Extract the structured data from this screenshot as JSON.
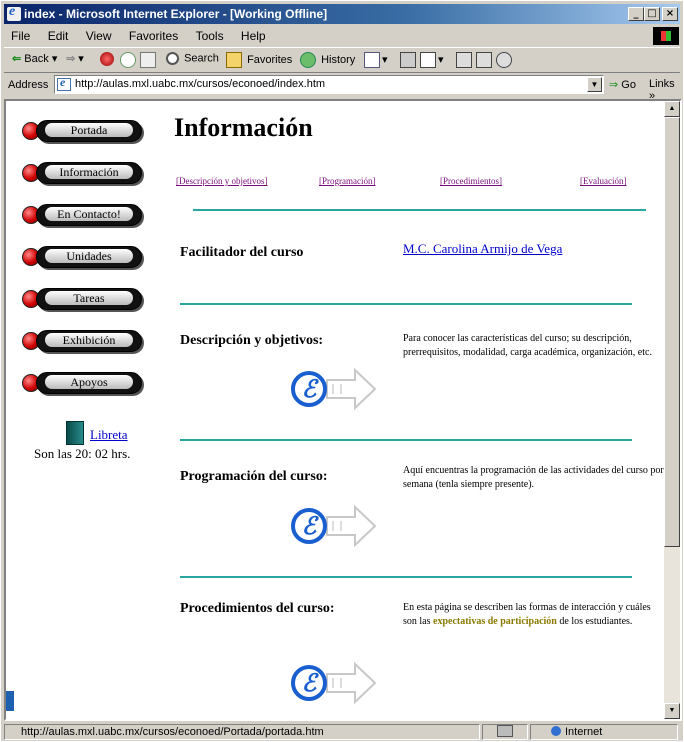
{
  "window": {
    "title": "index - Microsoft Internet Explorer - [Working Offline]",
    "min": "_",
    "max": "□",
    "close": "×"
  },
  "menu": [
    "File",
    "Edit",
    "View",
    "Favorites",
    "Tools",
    "Help"
  ],
  "toolbar": {
    "back": "Back",
    "search": "Search",
    "favorites": "Favorites",
    "history": "History"
  },
  "address": {
    "label": "Address",
    "url": "http://aulas.mxl.uabc.mx/cursos/econoed/index.htm",
    "go": "Go",
    "links": "Links »"
  },
  "nav": [
    "Portada",
    "Información",
    "En Contacto!",
    "Unidades",
    "Tareas",
    "Exhibición",
    "Apoyos"
  ],
  "sidebar": {
    "libreta": "Libreta",
    "clock": "Son las 20: 02 hrs."
  },
  "page": {
    "title": "Información",
    "toplinks": [
      "[Descripción y objetivos]",
      "[Programación]",
      "[Procedimientos]",
      "[Evaluación]"
    ],
    "facilitator_label": "Facilitador del curso",
    "facilitator_name": "M.C. Carolina Armijo de Vega",
    "sections": [
      {
        "heading": "Descripción y objetivos:",
        "text": "Para conocer las características del curso; su descripción, prerrequisitos, modalidad, carga académica, organización, etc."
      },
      {
        "heading": "Programación del curso:",
        "text": "Aquí encuentras la programación de las actividades del curso por semana (tenla siempre presente)."
      },
      {
        "heading": "Procedimientos del curso:",
        "text_before": "En esta página se describen las formas de interacción y cuáles son las",
        "text_highlight": "expectativas de participación",
        "text_after": "de los estudiantes."
      }
    ]
  },
  "status": {
    "url": "http://aulas.mxl.uabc.mx/cursos/econoed/Portada/portada.htm",
    "zone": "Internet"
  },
  "colors": {
    "rule": "#2aa6a0",
    "link": "#0000cc",
    "toplink": "#7a0a7a",
    "highlight": "#8a7a00"
  }
}
